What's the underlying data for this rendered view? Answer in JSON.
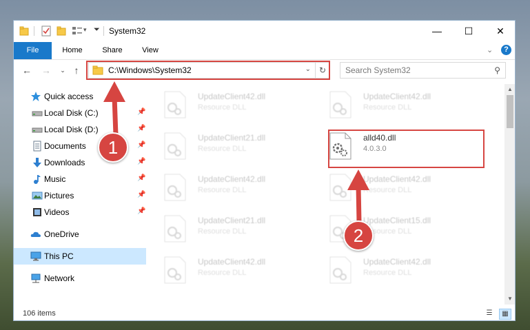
{
  "window": {
    "title": "System32",
    "controls": {
      "minimize": "—",
      "maximize": "☐",
      "close": "✕"
    }
  },
  "ribbon": {
    "tabs": [
      "File",
      "Home",
      "Share",
      "View"
    ]
  },
  "address": {
    "path": "C:\\Windows\\System32",
    "search_placeholder": "Search System32"
  },
  "nav": {
    "items": [
      {
        "label": "Quick access",
        "icon": "star-icon",
        "pinned": false
      },
      {
        "label": "Local Disk (C:)",
        "icon": "drive-icon",
        "pinned": true
      },
      {
        "label": "Local Disk (D:)",
        "icon": "drive-icon",
        "pinned": true
      },
      {
        "label": "Documents",
        "icon": "documents-icon",
        "pinned": true
      },
      {
        "label": "Downloads",
        "icon": "downloads-icon",
        "pinned": true
      },
      {
        "label": "Music",
        "icon": "music-icon",
        "pinned": true
      },
      {
        "label": "Pictures",
        "icon": "pictures-icon",
        "pinned": true
      },
      {
        "label": "Videos",
        "icon": "videos-icon",
        "pinned": true
      },
      {
        "label": "OneDrive",
        "icon": "onedrive-icon",
        "pinned": false
      },
      {
        "label": "This PC",
        "icon": "pc-icon",
        "pinned": false,
        "selected": true
      },
      {
        "label": "Network",
        "icon": "network-icon",
        "pinned": false
      }
    ]
  },
  "files": [
    {
      "name": "UpdateClient42.dll",
      "type": "Resource DLL",
      "faded": true
    },
    {
      "name": "UpdateClient42.dll",
      "type": "Resource DLL",
      "faded": true
    },
    {
      "name": "UpdateClient21.dll",
      "type": "Resource DLL",
      "faded": true
    },
    {
      "name": "alld40.dll",
      "type": "4.0.3.0",
      "faded": false
    },
    {
      "name": "UpdateClient42.dll",
      "type": "Resource DLL",
      "faded": true
    },
    {
      "name": "UpdateClient42.dll",
      "type": "Resource DLL",
      "faded": true
    },
    {
      "name": "UpdateClient21.dll",
      "type": "Resource DLL",
      "faded": true
    },
    {
      "name": "UpdateClient15.dll",
      "type": "Resource DLL",
      "faded": true
    },
    {
      "name": "UpdateClient42.dll",
      "type": "Resource DLL",
      "faded": true
    },
    {
      "name": "UpdateClient42.dll",
      "type": "Resource DLL",
      "faded": true
    }
  ],
  "status": {
    "item_count": "106 items"
  },
  "annotations": {
    "step1": "1",
    "step2": "2",
    "accent_color": "#d64541"
  }
}
